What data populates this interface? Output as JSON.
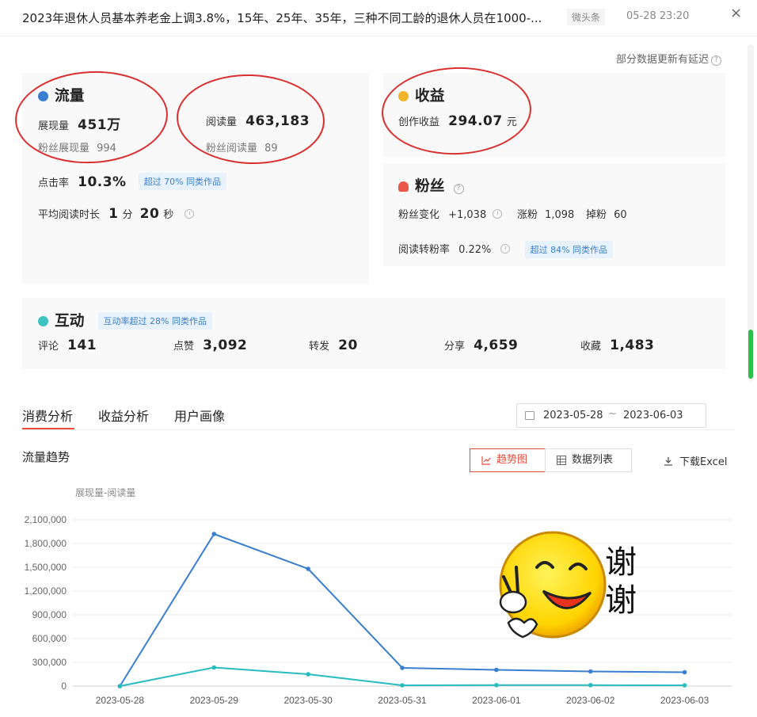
{
  "header": {
    "title": "2023年退休人员基本养老金上调3.8%，15年、25年、35年，三种不同工龄的退休人员在1000-...",
    "source": "微头条",
    "time": "05-28 23:20",
    "close": "×"
  },
  "note": "部分数据更新有延迟",
  "traffic": {
    "title": "流量",
    "impressions_label": "展现量",
    "impressions": "451万",
    "fan_impressions_label": "粉丝展现量",
    "fan_impressions": "994",
    "reads_label": "阅读量",
    "reads": "463,183",
    "fan_reads_label": "粉丝阅读量",
    "fan_reads": "89",
    "ctr_label": "点击率",
    "ctr": "10.3%",
    "ctr_badge": "超过 70% 同类作品",
    "avg_time_label": "平均阅读时长",
    "avg_time_min": "1",
    "avg_time_min_unit": "分",
    "avg_time_sec": "20",
    "avg_time_sec_unit": "秒"
  },
  "income": {
    "title": "收益",
    "label": "创作收益",
    "value": "294.07",
    "unit": "元"
  },
  "fans": {
    "title": "粉丝",
    "change_label": "粉丝变化",
    "change": "+1,038",
    "gain_label": "涨粉",
    "gain": "1,098",
    "loss_label": "掉粉",
    "loss": "60",
    "conv_label": "阅读转粉率",
    "conv": "0.22%",
    "conv_badge": "超过 84% 同类作品"
  },
  "interaction": {
    "title": "互动",
    "badge": "互动率超过 28% 同类作品",
    "items": [
      {
        "label": "评论",
        "value": "141"
      },
      {
        "label": "点赞",
        "value": "3,092"
      },
      {
        "label": "转发",
        "value": "20"
      },
      {
        "label": "分享",
        "value": "4,659"
      },
      {
        "label": "收藏",
        "value": "1,483"
      }
    ]
  },
  "tabs": [
    "消费分析",
    "收益分析",
    "用户画像"
  ],
  "date_range": {
    "start": "2023-05-28",
    "sep": "~",
    "end": "2023-06-03"
  },
  "trend": {
    "title": "流量趋势",
    "view_chart": "趋势图",
    "view_table": "数据列表",
    "download": "下载Excel"
  },
  "sticker_text": [
    "谢",
    "谢"
  ],
  "colors": {
    "accent": "#e84c3d",
    "impressions_line": "#3a7fcf",
    "reads_line": "#27bcc0"
  },
  "chart_data": {
    "type": "line",
    "ylabel": "展现量-阅读量",
    "x": [
      "2023-05-28",
      "2023-05-29",
      "2023-05-30",
      "2023-05-31",
      "2023-06-01",
      "2023-06-02",
      "2023-06-03"
    ],
    "yticks": [
      "2,100,000",
      "1,800,000",
      "1,500,000",
      "1,200,000",
      "900,000",
      "600,000",
      "300,000",
      "0"
    ],
    "ylim": [
      0,
      2100000
    ],
    "series": [
      {
        "values": [
          0,
          1920000,
          1480000,
          230000,
          205000,
          185000,
          175000
        ],
        "color": "#3a7fcf"
      },
      {
        "values": [
          0,
          235000,
          150000,
          10000,
          12000,
          12000,
          10000
        ],
        "color": "#27bcc0"
      }
    ]
  }
}
